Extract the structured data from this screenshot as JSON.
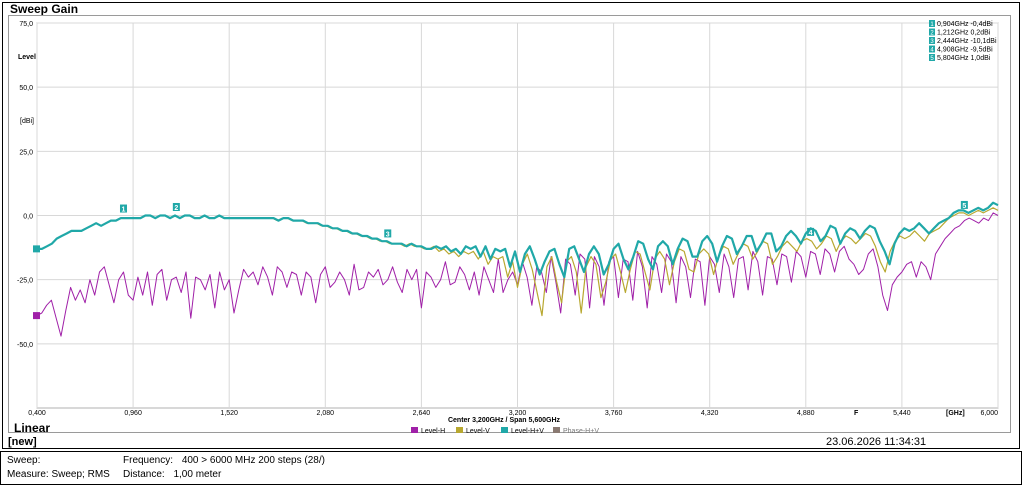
{
  "window": {
    "title": "Sweep Gain",
    "mode_label": "Linear",
    "status_name": "[new]",
    "datetime": "23.06.2026 11:34:31"
  },
  "info": {
    "sweep_label": "Sweep:",
    "frequency_label": "Frequency:",
    "frequency_value": "400 > 6000 MHz 200 steps (28/)",
    "measure_label": "Measure: Sweep; RMS",
    "distance_label": "Distance:",
    "distance_value": "1,00 meter"
  },
  "chart_data": {
    "type": "line",
    "ylabel_top": "Level",
    "yunit": "[dBi]",
    "xunit": "[GHz]",
    "x_extra_label": "F",
    "center_span": "Center 3,200GHz / Span 5,600GHz",
    "xlim": [
      0.4,
      6.0
    ],
    "ylim": [
      -75,
      75
    ],
    "yticks": [
      "75,0",
      "50,0",
      "25,0",
      "0,0",
      "-25,0",
      "-50,0"
    ],
    "ytick_values": [
      75,
      50,
      25,
      0,
      -25,
      -50
    ],
    "xticks": [
      "0,400",
      "0,960",
      "1,520",
      "2,080",
      "2,640",
      "3,200",
      "3,760",
      "4,320",
      "4,880",
      "5,440",
      "6,000"
    ],
    "xtick_values": [
      0.4,
      0.96,
      1.52,
      2.08,
      2.64,
      3.2,
      3.76,
      4.32,
      4.88,
      5.44,
      6.0
    ],
    "colors": {
      "level_h": "#a020a8",
      "level_v": "#b8a830",
      "level_hv": "#20a8a8",
      "phase_hv": "#8a7a72",
      "grid": "#d8d8d8"
    },
    "legend": [
      "Level-H",
      "Level-V",
      "Level-H+V",
      "Phase-H+V"
    ],
    "markers": [
      {
        "id": "1",
        "x": 0.904,
        "y": -0.4,
        "text": "0,904GHz -0,4dBi"
      },
      {
        "id": "2",
        "x": 1.212,
        "y": 0.2,
        "text": "1,212GHz 0,2dBi"
      },
      {
        "id": "3",
        "x": 2.444,
        "y": -10.1,
        "text": "2,444GHz -10,1dBi"
      },
      {
        "id": "4",
        "x": 4.908,
        "y": -9.5,
        "text": "4,908GHz -9,5dBi"
      },
      {
        "id": "5",
        "x": 5.804,
        "y": 1.0,
        "text": "5,804GHz 1,0dBi"
      }
    ],
    "series": [
      {
        "name": "Level-H",
        "values": [
          -39,
          -38,
          -35,
          -33,
          -40,
          -47,
          -37,
          -28,
          -33,
          -29,
          -34,
          -25,
          -31,
          -22,
          -20,
          -27,
          -34,
          -25,
          -22,
          -31,
          -33,
          -24,
          -31,
          -22,
          -35,
          -23,
          -21,
          -33,
          -25,
          -24,
          -30,
          -22,
          -40,
          -24,
          -25,
          -29,
          -23,
          -36,
          -22,
          -29,
          -25,
          -38,
          -29,
          -21,
          -24,
          -22,
          -27,
          -20,
          -24,
          -31,
          -20,
          -22,
          -28,
          -22,
          -23,
          -31,
          -22,
          -24,
          -34,
          -23,
          -20,
          -28,
          -26,
          -22,
          -25,
          -31,
          -19,
          -29,
          -28,
          -22,
          -24,
          -21,
          -27,
          -25,
          -20,
          -26,
          -30,
          -21,
          -25,
          -21,
          -36,
          -22,
          -24,
          -28,
          -25,
          -18,
          -27,
          -26,
          -20,
          -23,
          -29,
          -22,
          -31,
          -20,
          -25,
          -30,
          -17,
          -30,
          -25,
          -22,
          -27,
          -18,
          -24,
          -35,
          -20,
          -22,
          -30,
          -16,
          -26,
          -38,
          -17,
          -19,
          -31,
          -15,
          -17,
          -36,
          -16,
          -20,
          -35,
          -18,
          -16,
          -32,
          -17,
          -18,
          -33,
          -14,
          -20,
          -36,
          -16,
          -19,
          -30,
          -15,
          -18,
          -34,
          -16,
          -20,
          -32,
          -17,
          -18,
          -35,
          -16,
          -19,
          -30,
          -15,
          -20,
          -32,
          -17,
          -16,
          -29,
          -14,
          -18,
          -31,
          -16,
          -17,
          -27,
          -15,
          -16,
          -26,
          -14,
          -16,
          -24,
          -14,
          -15,
          -23,
          -13,
          -15,
          -22,
          -14,
          -12,
          -17,
          -19,
          -23,
          -21,
          -15,
          -13,
          -20,
          -31,
          -37,
          -27,
          -24,
          -22,
          -19,
          -18,
          -24,
          -18,
          -20,
          -25,
          -15,
          -12,
          -9,
          -7,
          -5,
          -4,
          -2,
          -1,
          -2,
          -3,
          -1,
          -2,
          1,
          0
        ]
      },
      {
        "name": "Level-V",
        "values": [
          -13,
          -13,
          -12,
          -11,
          -9,
          -8,
          -7,
          -6,
          -6,
          -6,
          -5,
          -4,
          -3,
          -4,
          -3,
          -2,
          -2,
          -1,
          -1,
          -1,
          -1,
          -1,
          0,
          0,
          -1,
          0,
          0,
          -1,
          0,
          -1,
          0,
          0,
          -1,
          -1,
          0,
          -1,
          -1,
          0,
          -1,
          -1,
          -1,
          -1,
          -1,
          -1,
          -1,
          -1,
          -1,
          -1,
          -1,
          -2,
          -1,
          -1,
          -2,
          -2,
          -2,
          -3,
          -3,
          -3,
          -4,
          -4,
          -5,
          -5,
          -6,
          -6,
          -7,
          -7,
          -8,
          -8,
          -9,
          -9,
          -10,
          -10,
          -11,
          -11,
          -11,
          -12,
          -11,
          -12,
          -12,
          -13,
          -13,
          -12,
          -14,
          -13,
          -15,
          -14,
          -16,
          -14,
          -15,
          -14,
          -17,
          -14,
          -19,
          -16,
          -17,
          -16,
          -24,
          -18,
          -28,
          -19,
          -15,
          -21,
          -30,
          -39,
          -20,
          -16,
          -26,
          -34,
          -18,
          -16,
          -22,
          -38,
          -20,
          -16,
          -19,
          -32,
          -26,
          -17,
          -15,
          -22,
          -30,
          -21,
          -14,
          -15,
          -22,
          -29,
          -17,
          -14,
          -17,
          -27,
          -18,
          -13,
          -14,
          -21,
          -22,
          -15,
          -13,
          -15,
          -23,
          -16,
          -12,
          -13,
          -19,
          -15,
          -11,
          -12,
          -17,
          -14,
          -10,
          -11,
          -19,
          -16,
          -12,
          -10,
          -12,
          -14,
          -10,
          -9,
          -10,
          -13,
          -11,
          -8,
          -9,
          -14,
          -10,
          -8,
          -9,
          -11,
          -9,
          -7,
          -8,
          -12,
          -18,
          -22,
          -14,
          -10,
          -8,
          -9,
          -8,
          -6,
          -8,
          -10,
          -7,
          -6,
          -5,
          -3,
          -1,
          0,
          1,
          1,
          0,
          1,
          2,
          1,
          2,
          3,
          2
        ]
      },
      {
        "name": "Level-H+V",
        "values": [
          -13,
          -13,
          -12,
          -11,
          -9,
          -8,
          -7,
          -6,
          -6,
          -6,
          -5,
          -4,
          -3,
          -4,
          -3,
          -2,
          -2,
          -1,
          -1,
          -1,
          -1,
          -1,
          0,
          0,
          -1,
          0,
          0,
          -1,
          0,
          -1,
          0,
          0,
          -1,
          -1,
          0,
          -1,
          -1,
          0,
          -1,
          -1,
          -1,
          -1,
          -1,
          -1,
          -1,
          -1,
          -1,
          -1,
          -1,
          -2,
          -1,
          -1,
          -2,
          -2,
          -2,
          -3,
          -3,
          -3,
          -4,
          -4,
          -5,
          -5,
          -6,
          -6,
          -7,
          -7,
          -8,
          -8,
          -9,
          -9,
          -10,
          -10,
          -11,
          -11,
          -11,
          -12,
          -11,
          -12,
          -12,
          -13,
          -13,
          -12,
          -13,
          -12,
          -14,
          -13,
          -15,
          -12,
          -13,
          -12,
          -16,
          -12,
          -17,
          -13,
          -14,
          -13,
          -20,
          -14,
          -22,
          -15,
          -12,
          -17,
          -23,
          -18,
          -14,
          -13,
          -19,
          -24,
          -13,
          -12,
          -17,
          -22,
          -15,
          -12,
          -15,
          -23,
          -19,
          -13,
          -11,
          -17,
          -21,
          -16,
          -10,
          -11,
          -17,
          -21,
          -12,
          -10,
          -12,
          -19,
          -13,
          -9,
          -10,
          -16,
          -16,
          -10,
          -8,
          -11,
          -18,
          -12,
          -8,
          -9,
          -15,
          -12,
          -8,
          -8,
          -14,
          -11,
          -7,
          -7,
          -14,
          -12,
          -8,
          -6,
          -8,
          -11,
          -7,
          -5,
          -6,
          -10,
          -8,
          -4,
          -5,
          -11,
          -7,
          -5,
          -6,
          -9,
          -6,
          -4,
          -5,
          -10,
          -14,
          -19,
          -11,
          -7,
          -5,
          -6,
          -5,
          -3,
          -5,
          -7,
          -5,
          -3,
          -2,
          -1,
          1,
          2,
          2,
          1,
          2,
          3,
          2,
          3,
          5,
          4
        ]
      }
    ]
  }
}
